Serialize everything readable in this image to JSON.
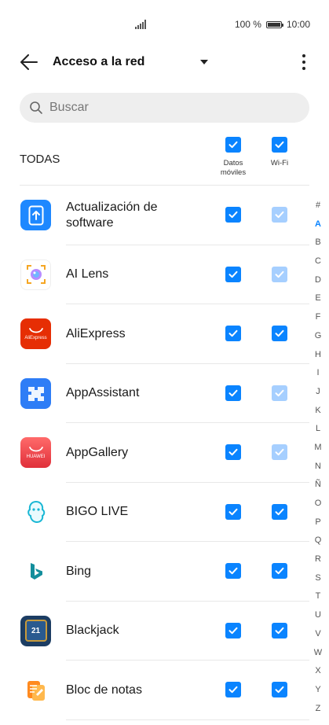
{
  "status": {
    "battery_text": "100 %",
    "time": "10:00"
  },
  "header": {
    "title": "Acceso a la red"
  },
  "search": {
    "placeholder": "Buscar"
  },
  "columns": {
    "all_label": "TODAS",
    "mobile_label_1": "Datos",
    "mobile_label_2": "móviles",
    "wifi_label": "Wi-Fi"
  },
  "apps": [
    {
      "name": "Actualización de software",
      "icon": "software-update-icon",
      "mobile": "on",
      "wifi": "on-dimmed"
    },
    {
      "name": "AI Lens",
      "icon": "ai-lens-icon",
      "mobile": "on",
      "wifi": "on-dimmed"
    },
    {
      "name": "AliExpress",
      "icon": "aliexpress-icon",
      "mobile": "on",
      "wifi": "on"
    },
    {
      "name": "AppAssistant",
      "icon": "app-assistant-icon",
      "mobile": "on",
      "wifi": "on-dimmed"
    },
    {
      "name": "AppGallery",
      "icon": "appgallery-icon",
      "mobile": "on",
      "wifi": "on-dimmed"
    },
    {
      "name": "BIGO LIVE",
      "icon": "bigo-live-icon",
      "mobile": "on",
      "wifi": "on"
    },
    {
      "name": "Bing",
      "icon": "bing-icon",
      "mobile": "on",
      "wifi": "on"
    },
    {
      "name": "Blackjack",
      "icon": "blackjack-icon",
      "mobile": "on",
      "wifi": "on"
    },
    {
      "name": "Bloc de notas",
      "icon": "notepad-icon",
      "mobile": "on",
      "wifi": "on"
    }
  ],
  "icon_text": {
    "aliexpress": "AliExpress",
    "huawei": "HUAWEI",
    "blackjack": "21"
  },
  "alphabet": [
    "#",
    "A",
    "B",
    "C",
    "D",
    "E",
    "F",
    "G",
    "H",
    "I",
    "J",
    "K",
    "L",
    "M",
    "N",
    "Ñ",
    "O",
    "P",
    "Q",
    "R",
    "S",
    "T",
    "U",
    "V",
    "W",
    "X",
    "Y",
    "Z"
  ],
  "alphabet_active": "A",
  "colors": {
    "accent": "#0a84ff",
    "accent_dimmed": "#a6cfff"
  }
}
